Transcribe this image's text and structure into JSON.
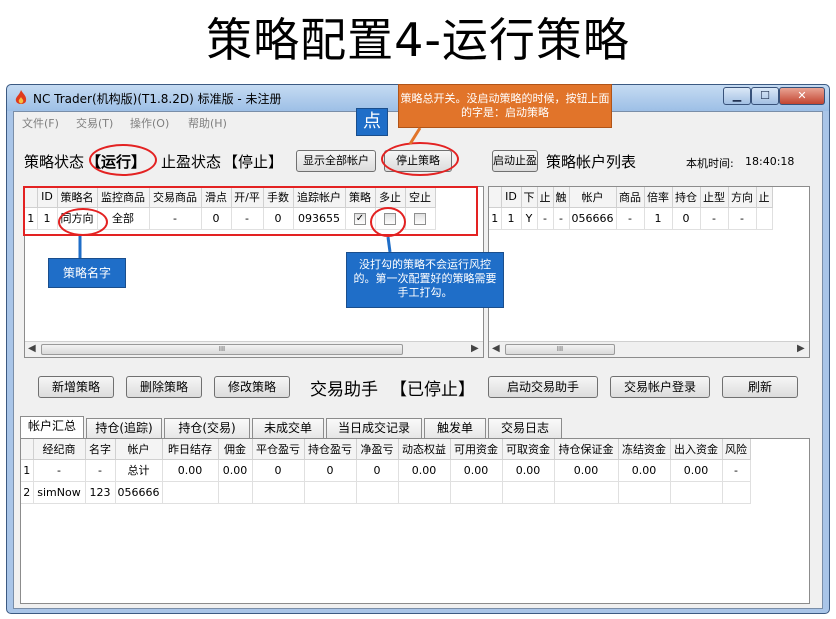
{
  "slide_title": "策略配置4-运行策略",
  "window": {
    "title": "NC Trader(机构版)(T1.8.2D) 标准版 - 未注册",
    "controls": {
      "minimize": "▁",
      "maximize": "☐",
      "close": "✕"
    }
  },
  "menu": [
    "文件(F)",
    "交易(T)",
    "操作(O)",
    "帮助(H)"
  ],
  "status": {
    "strategy_label": "策略状态",
    "strategy_value": "【运行】",
    "takeprofit_label": "止盈状态",
    "takeprofit_value": "【停止】",
    "show_all_accounts": "显示全部帐户",
    "stop_strategy": "停止策略",
    "start_takeprofit": "启动止盈",
    "account_list_label": "策略帐户列表",
    "local_time_label": "本机时间:",
    "local_time_value": "18:40:18"
  },
  "strategy_table": {
    "headers": [
      "",
      "ID",
      "策略名",
      "监控商品",
      "交易商品",
      "滑点",
      "开/平",
      "手数",
      "追踪帐户",
      "策略",
      "多止",
      "空止"
    ],
    "rows": [
      {
        "idx": "1",
        "id": "1",
        "name": "同方向",
        "monitor": "全部",
        "trade": "-",
        "slip": "0",
        "openclose": "-",
        "lots": "0",
        "account": "093655",
        "strategy": "✓",
        "long_stop": "",
        "short_stop": ""
      }
    ]
  },
  "account_table": {
    "headers": [
      "",
      "ID",
      "下",
      "止",
      "触",
      "帐户",
      "商品",
      "倍率",
      "持仓",
      "止型",
      "方向",
      "止"
    ],
    "rows": [
      {
        "idx": "1",
        "id": "1",
        "down": "Y",
        "stop": "-",
        "trigger": "-",
        "account": "056666",
        "product": "-",
        "ratio": "1",
        "position": "0",
        "stop_type": "-",
        "direction": "-",
        "extra": ""
      }
    ]
  },
  "scroll": {
    "thumb": "III",
    "left": "◀",
    "right": "▶"
  },
  "actions": {
    "add_strategy": "新增策略",
    "delete_strategy": "删除策略",
    "modify_strategy": "修改策略",
    "assistant_label": "交易助手",
    "assistant_value": "【已停止】",
    "start_assistant": "启动交易助手",
    "account_login": "交易帐户登录",
    "refresh": "刷新"
  },
  "tabs": [
    "帐户汇总",
    "持仓(追踪)",
    "持仓(交易)",
    "未成交单",
    "当日成交记录",
    "触发单",
    "交易日志"
  ],
  "summary_table": {
    "headers": [
      "",
      "经纪商",
      "名字",
      "帐户",
      "昨日结存",
      "佣金",
      "平仓盈亏",
      "持仓盈亏",
      "净盈亏",
      "动态权益",
      "可用资金",
      "可取资金",
      "持仓保证金",
      "冻结资金",
      "出入资金",
      "风险"
    ],
    "rows": [
      [
        "1",
        "-",
        "-",
        "总计",
        "0.00",
        "0.00",
        "0",
        "0",
        "0",
        "0.00",
        "0.00",
        "0.00",
        "0.00",
        "0.00",
        "0.00",
        "-"
      ],
      [
        "2",
        "simNow",
        "123",
        "056666",
        "",
        "",
        "",
        "",
        "",
        "",
        "",
        "",
        "",
        "",
        "",
        ""
      ]
    ]
  },
  "annotations": {
    "click_hint": "点",
    "switch_note": "策略总开关。没启动策略的时候，按钮上面的字是：启动策略",
    "name_note": "策略名字",
    "checkbox_note": "没打勾的策略不会运行风控的。第一次配置好的策略需要手工打勾。"
  },
  "colors": {
    "callout_blue": "#1f6ec8",
    "callout_orange": "#e1742a",
    "highlight_red": "#e32222",
    "window_frame": "#a9c5e8"
  }
}
